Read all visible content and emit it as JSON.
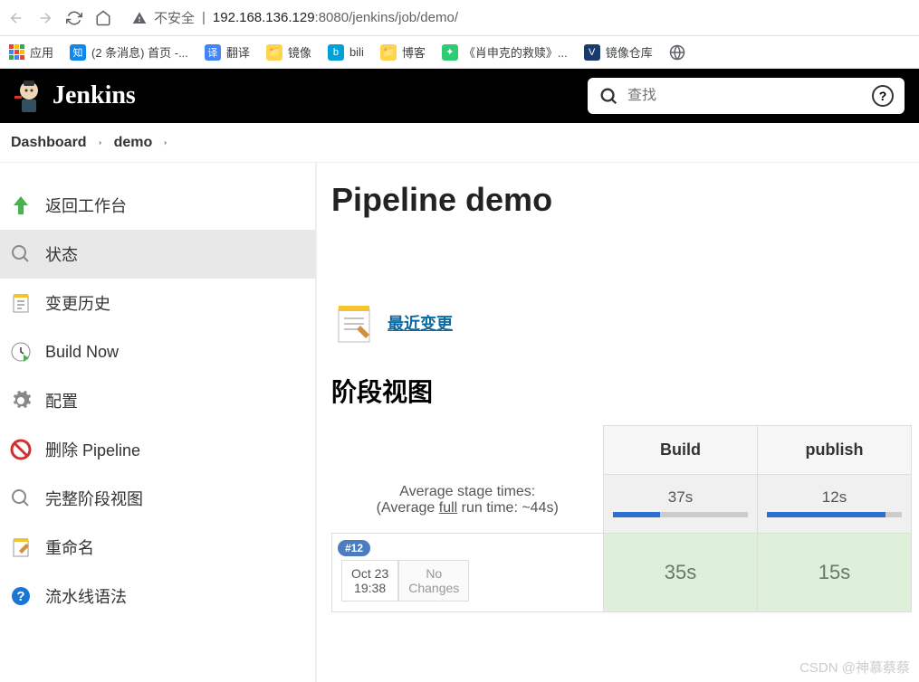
{
  "browser": {
    "insecure_label": "不安全",
    "url_host": "192.168.136.129",
    "url_port": ":8080",
    "url_path": "/jenkins/job/demo/",
    "bookmarks": {
      "apps": "应用",
      "zhihu": "(2 条消息) 首页 -...",
      "translate": "翻译",
      "mirror": "镜像",
      "bili": "bili",
      "blog": "博客",
      "shawshank": "《肖申克的救赎》...",
      "mirror_repo": "镜像仓库"
    }
  },
  "header": {
    "brand": "Jenkins",
    "search_placeholder": "查找"
  },
  "breadcrumb": {
    "dashboard": "Dashboard",
    "job": "demo"
  },
  "sidebar": {
    "back": "返回工作台",
    "status": "状态",
    "changes": "变更历史",
    "build_now": "Build Now",
    "configure": "配置",
    "delete": "删除 Pipeline",
    "full_stage": "完整阶段视图",
    "rename": "重命名",
    "pipeline_syntax": "流水线语法"
  },
  "main": {
    "title": "Pipeline demo",
    "recent_changes": "最近变更",
    "stage_view_title": "阶段视图",
    "avg_label": "Average stage times:",
    "avg_full_pre": "(Average ",
    "avg_full_mid": "full",
    "avg_full_post": " run time: ~44s)",
    "build_badge": "#12",
    "run_date": "Oct 23",
    "run_time": "19:38",
    "no_changes": "No Changes"
  },
  "chart_data": {
    "type": "table",
    "title": "阶段视图",
    "columns": [
      "Build",
      "publish"
    ],
    "rows": [
      {
        "label": "Average stage times",
        "values": [
          "37s",
          "12s"
        ],
        "progress_pct": [
          35,
          88
        ]
      },
      {
        "label": "#12",
        "date": "Oct 23 19:38",
        "changes": "No Changes",
        "values": [
          "35s",
          "15s"
        ]
      }
    ],
    "full_run_time": "~44s"
  },
  "watermark": "CSDN @神慕蔡蔡"
}
